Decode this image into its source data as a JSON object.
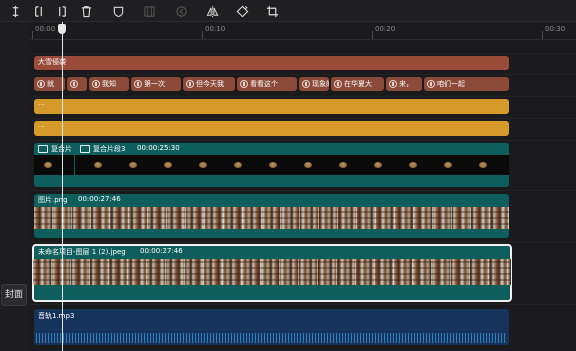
{
  "toolbar": {
    "buttons": [
      {
        "icon": "split-icon"
      },
      {
        "icon": "trim-left-icon"
      },
      {
        "icon": "trim-right-icon"
      },
      {
        "icon": "delete-icon"
      },
      {
        "icon": "mask-icon"
      },
      {
        "icon": "freeze-frame-icon"
      },
      {
        "icon": "reverse-icon"
      },
      {
        "icon": "mirror-icon"
      },
      {
        "icon": "rotate-icon"
      },
      {
        "icon": "crop-icon"
      }
    ]
  },
  "gutter": {
    "cover_label": "封面"
  },
  "ruler": {
    "ticks": [
      "00:00",
      "00:10",
      "00:20",
      "00:30"
    ]
  },
  "tracks": {
    "text": {
      "label": "大雪侵袭"
    },
    "subtitles": [
      "就",
      "",
      "我知",
      "第一次",
      "但今天我",
      "看看这个",
      "现象的",
      "在华夏大",
      "来，",
      "咱们一起"
    ],
    "effect1": {
      "label": "..."
    },
    "effect2": {
      "label": "..."
    },
    "compound": {
      "label1": "复合片",
      "label2": "复合片段3",
      "duration": "00:00:25:30"
    },
    "image1": {
      "name": "图片.png",
      "duration": "00:00:27:46"
    },
    "image2": {
      "name": "未命名项目-图层 1 (2).jpeg",
      "duration": "00:00:27:46"
    },
    "audio": {
      "name": "音轨1.mp3"
    }
  },
  "colors": {
    "text_track": "#9a4b3a",
    "subtitle": "#8c4a3b",
    "effect": "#d69a2a",
    "video": "#0f5e5e",
    "audio": "#16335c",
    "selection": "#f2f2f2"
  }
}
